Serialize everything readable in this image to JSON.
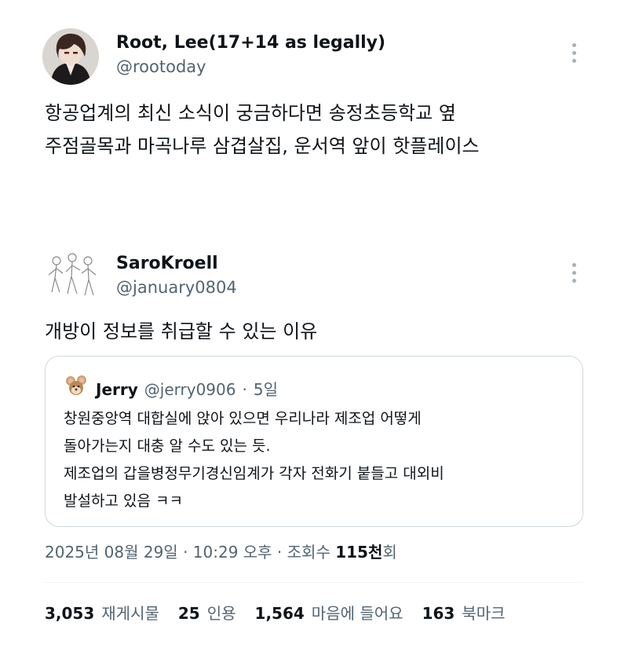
{
  "tweet": {
    "author_name": "Root, Lee(17+14 as legally)",
    "author_handle": "@rootoday",
    "text": "항공업계의 최신 소식이 궁금하다면 송정초등학교 옆\n주점골목과 마곡나루 삼겹살집, 운서역 앞이 핫플레이스"
  },
  "reply": {
    "author_name": "SaroKroell",
    "author_handle": "@january0804",
    "text": "개방이 정보를 취급할 수 있는 이유",
    "quoted": {
      "author_name": "Jerry",
      "author_handle": "@jerry0906",
      "separator": "·",
      "age": "5일",
      "text": "창원중앙역 대합실에 앉아 있으면 우리나라 제조업 어떻게\n돌아가는지 대충 알 수도 있는 듯.\n제조업의 갑을병정무기경신임계가 각자 전화기 붙들고 대외비\n발설하고 있음 ㅋㅋ"
    },
    "timestamp": "2025년 08월 29일 · 10:29 오후 · 조회수 ",
    "views_count": "115천",
    "views_suffix": "회",
    "stats": {
      "retweets_count": "3,053",
      "retweets_label": "재게시물",
      "quotes_count": "25",
      "quotes_label": "인용",
      "likes_count": "1,564",
      "likes_label": "마음에 들어요",
      "bookmarks_count": "163",
      "bookmarks_label": "북마크"
    }
  }
}
